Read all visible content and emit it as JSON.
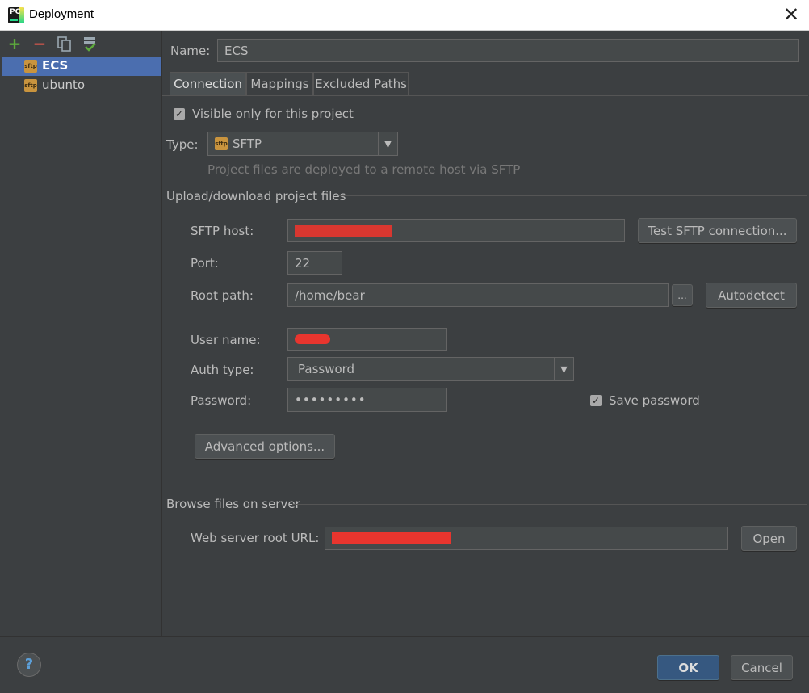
{
  "window": {
    "title": "Deployment",
    "app_icon_text": "PC"
  },
  "toolbar": {
    "add": "+",
    "remove": "−"
  },
  "servers": [
    {
      "name": "ECS",
      "icon": "sftp-icon",
      "selected": true
    },
    {
      "name": "ubunto",
      "icon": "sftp-icon",
      "selected": false
    }
  ],
  "icon_text": "sftp",
  "name_field": {
    "label": "Name:",
    "value": "ECS"
  },
  "tabs": [
    {
      "label": "Connection",
      "active": true
    },
    {
      "label": "Mappings",
      "active": false
    },
    {
      "label": "Excluded Paths",
      "active": false
    }
  ],
  "connection": {
    "visible_only_label": "Visible only for this project",
    "visible_only_checked": true,
    "type_label": "Type:",
    "type_value": "SFTP",
    "type_hint": "Project files are deployed to a remote host via SFTP",
    "upload_section": "Upload/download project files",
    "host_label": "SFTP host:",
    "test_button": "Test SFTP connection...",
    "port_label": "Port:",
    "port_value": "22",
    "root_label": "Root path:",
    "root_value": "/home/bear",
    "browse_button": "...",
    "autodetect_button": "Autodetect",
    "user_label": "User name:",
    "auth_label": "Auth type:",
    "auth_value": "Password",
    "password_label": "Password:",
    "password_value": "•••••••••",
    "save_password_label": "Save password",
    "save_password_checked": true,
    "advanced_button": "Advanced options...",
    "browse_section": "Browse files on server",
    "web_root_label": "Web server root URL:",
    "open_button": "Open"
  },
  "footer": {
    "help": "?",
    "ok": "OK",
    "cancel": "Cancel"
  },
  "colors": {
    "accent": "#4b6eaf",
    "add": "#5daa3c",
    "remove": "#c7554b",
    "redaction": "#e8352e"
  }
}
